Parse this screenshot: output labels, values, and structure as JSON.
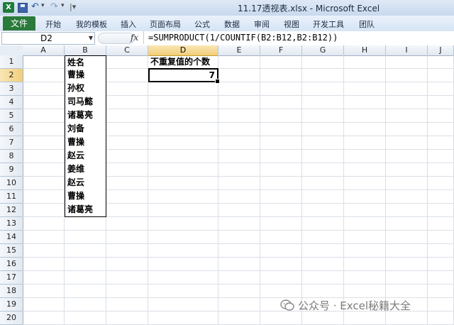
{
  "window": {
    "title": "11.17透视表.xlsx - Microsoft Excel"
  },
  "ribbon": {
    "file_tab": "文件",
    "tabs": [
      "开始",
      "我的模板",
      "插入",
      "页面布局",
      "公式",
      "数据",
      "审阅",
      "视图",
      "开发工具",
      "团队"
    ]
  },
  "formula_bar": {
    "name_box": "D2",
    "fx": "fx",
    "formula": "=SUMPRODUCT(1/COUNTIF(B2:B12,B2:B12))"
  },
  "sheet": {
    "columns": [
      "A",
      "B",
      "C",
      "D",
      "E",
      "F",
      "G",
      "H",
      "I",
      "J"
    ],
    "selected_column": "D",
    "rows": [
      "1",
      "2",
      "3",
      "4",
      "5",
      "6",
      "7",
      "8",
      "9",
      "10",
      "11",
      "12",
      "13",
      "14",
      "15",
      "16",
      "17",
      "18",
      "19",
      "20"
    ],
    "selected_row": "2",
    "b_column": [
      "姓名",
      "曹操",
      "孙权",
      "司马懿",
      "诸葛亮",
      "刘备",
      "曹操",
      "赵云",
      "姜维",
      "赵云",
      "曹操",
      "诸葛亮"
    ],
    "d1": "不重复值的个数",
    "d2": "7"
  },
  "watermark": {
    "text": "公众号 · Excel秘籍大全"
  }
}
